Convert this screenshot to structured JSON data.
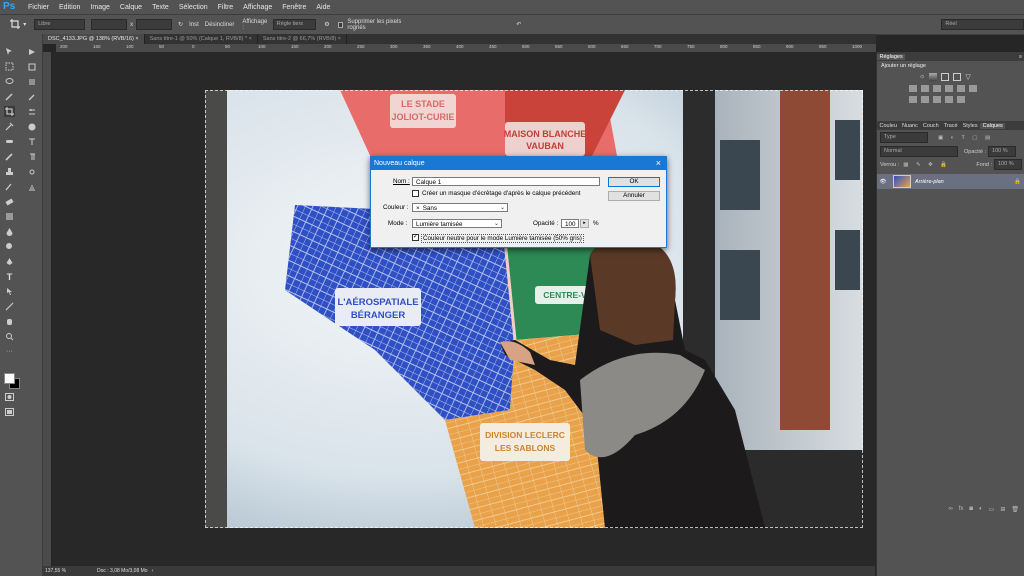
{
  "app": {
    "logo": "Ps",
    "menus": [
      "Fichier",
      "Edition",
      "Image",
      "Calque",
      "Texte",
      "Sélection",
      "Filtre",
      "Affichage",
      "Fenêtre",
      "Aide"
    ]
  },
  "options_bar": {
    "style_value": "Libre",
    "x_label": "x",
    "swap_label": "Inst",
    "unlock_label": "Désincliner",
    "display_label": "Affichage :",
    "display_value": "Règle tiers",
    "delete_pixels_label": "Supprimer les pixels rognés",
    "workspace_value": "Réel"
  },
  "tabs": [
    {
      "label": "DSC_4133.JPG @ 138% (RVB/16)",
      "close": "×"
    },
    {
      "label": "Sans titre-1 @ 50% (Calque 1, RVB/8) *",
      "close": "×"
    },
    {
      "label": "Sans titre-2 @ 66,7% (RVB/8)",
      "close": "×"
    }
  ],
  "ruler_ticks": [
    "200",
    "150",
    "100",
    "50",
    "0",
    "50",
    "100",
    "150",
    "200",
    "250",
    "300",
    "350",
    "400",
    "450",
    "500",
    "550",
    "600",
    "650",
    "700",
    "750",
    "800",
    "850",
    "900",
    "950",
    "1000"
  ],
  "photo_text": {
    "stade_line1": "LE STADE",
    "stade_line2": "JOLIOT-CURIE",
    "maison_line1": "MAISON BLANCHE",
    "maison_line2": "VAUBAN",
    "aero_line1": "L'AÉROSPATIALE",
    "aero_line2": "BÉRANGER",
    "centre": "CENTRE-V",
    "division_line1": "DIVISION LECLERC",
    "division_line2": "LES SABLONS"
  },
  "status": {
    "zoom": "137,55 %",
    "doc": "Doc : 3,08 Mo/3,08 Mo"
  },
  "adjustments_panel": {
    "tab": "Réglages",
    "subtitle": "Ajouter un réglage"
  },
  "layers_panel": {
    "tabs": [
      "Couleu",
      "Nuanc",
      "Couch",
      "Tracé",
      "Styles",
      "Calques"
    ],
    "filter_value": "Type",
    "blend_value": "Normal",
    "opacity_label": "Opacité :",
    "opacity_value": "100 %",
    "lock_label": "Verrou :",
    "fill_label": "Fond :",
    "fill_value": "100 %",
    "layer_name": "Arrière-plan"
  },
  "dialog": {
    "title": "Nouveau calque",
    "close": "×",
    "name_label": "Nom :",
    "name_value": "Calque 1",
    "clip_label": "Créer un masque d'écrêtage d'après le calque précédent",
    "color_label": "Couleur :",
    "color_value": "Sans",
    "color_prefix": "×",
    "mode_label": "Mode :",
    "mode_value": "Lumière tamisée",
    "opacity_label": "Opacité :",
    "opacity_value": "100",
    "opacity_unit": "%",
    "neutral_label": "Couleur neutre pour le mode Lumière tamisée (50% gris)",
    "ok_label": "OK",
    "cancel_label": "Annuler",
    "checkmark": "✓"
  },
  "colors": {
    "chrome": "#535353",
    "dialog_accent": "#1878d4",
    "ps_blue": "#31a8ff"
  }
}
